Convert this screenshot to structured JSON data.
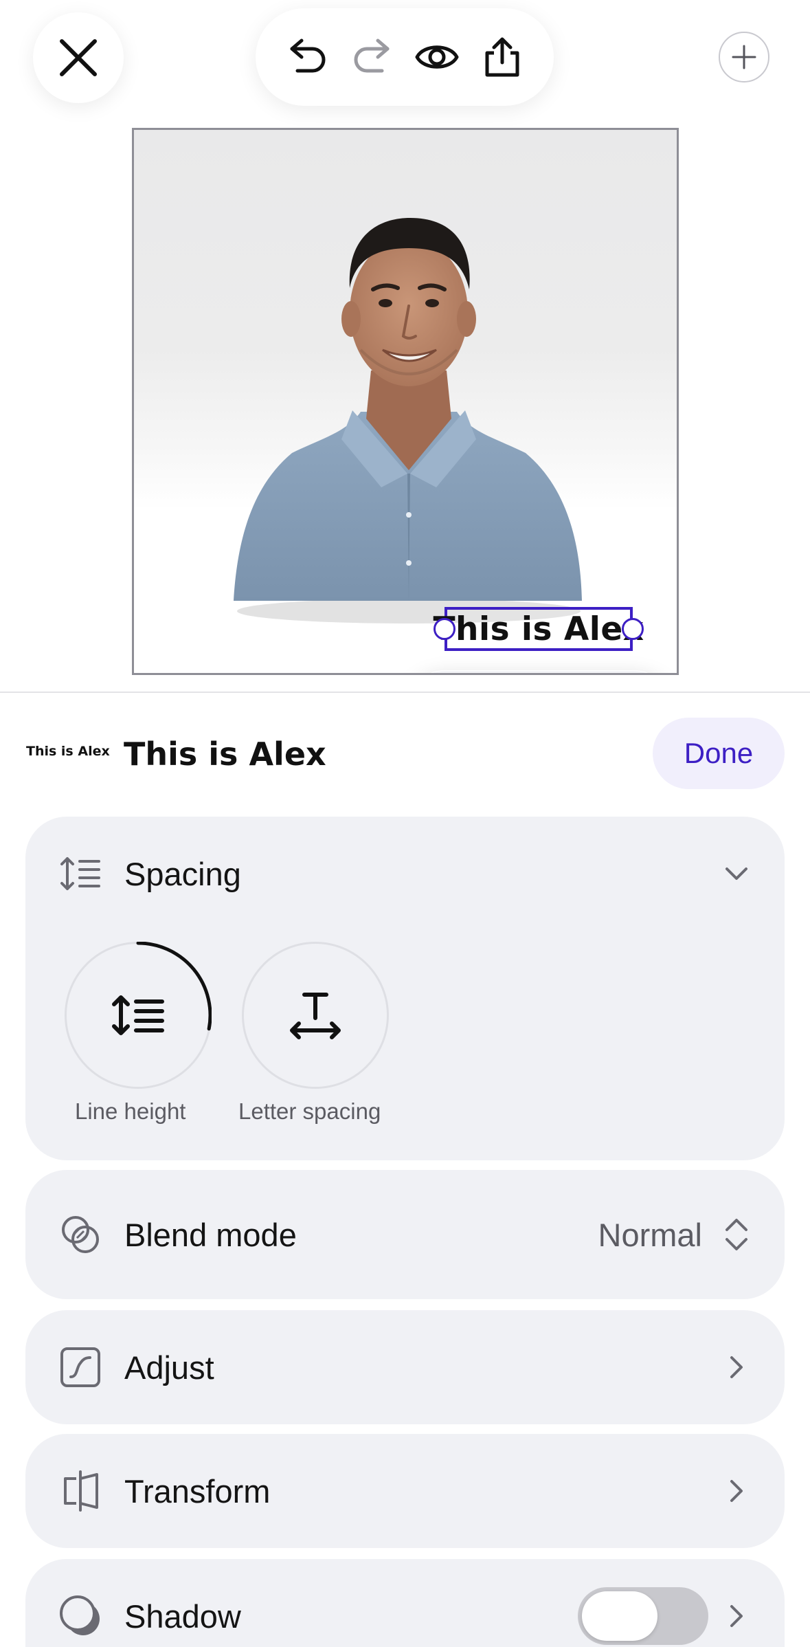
{
  "toolbar": {
    "close_icon": "close-icon",
    "undo_icon": "undo-icon",
    "redo_icon": "redo-icon",
    "preview_icon": "eye-icon",
    "share_icon": "share-icon",
    "add_icon": "plus-icon"
  },
  "canvas": {
    "text_layer": "This is Alex",
    "floating_actions": [
      "keyboard-icon",
      "trash-icon",
      "more-icon"
    ]
  },
  "panel": {
    "font_preview": "This is Alex",
    "title": "This is Alex",
    "done_label": "Done"
  },
  "spacing": {
    "label": "Spacing",
    "line_height_label": "Line height",
    "letter_spacing_label": "Letter spacing",
    "line_height_dial_fraction": 0.28
  },
  "blend_mode": {
    "label": "Blend mode",
    "value": "Normal"
  },
  "adjust": {
    "label": "Adjust"
  },
  "transform": {
    "label": "Transform"
  },
  "shadow": {
    "label": "Shadow",
    "enabled": false
  },
  "colors": {
    "accent": "#3d1fc4",
    "done_bg": "#f1effc",
    "card_bg": "#f0f1f5",
    "toggle_off": "#c8c8cd"
  }
}
